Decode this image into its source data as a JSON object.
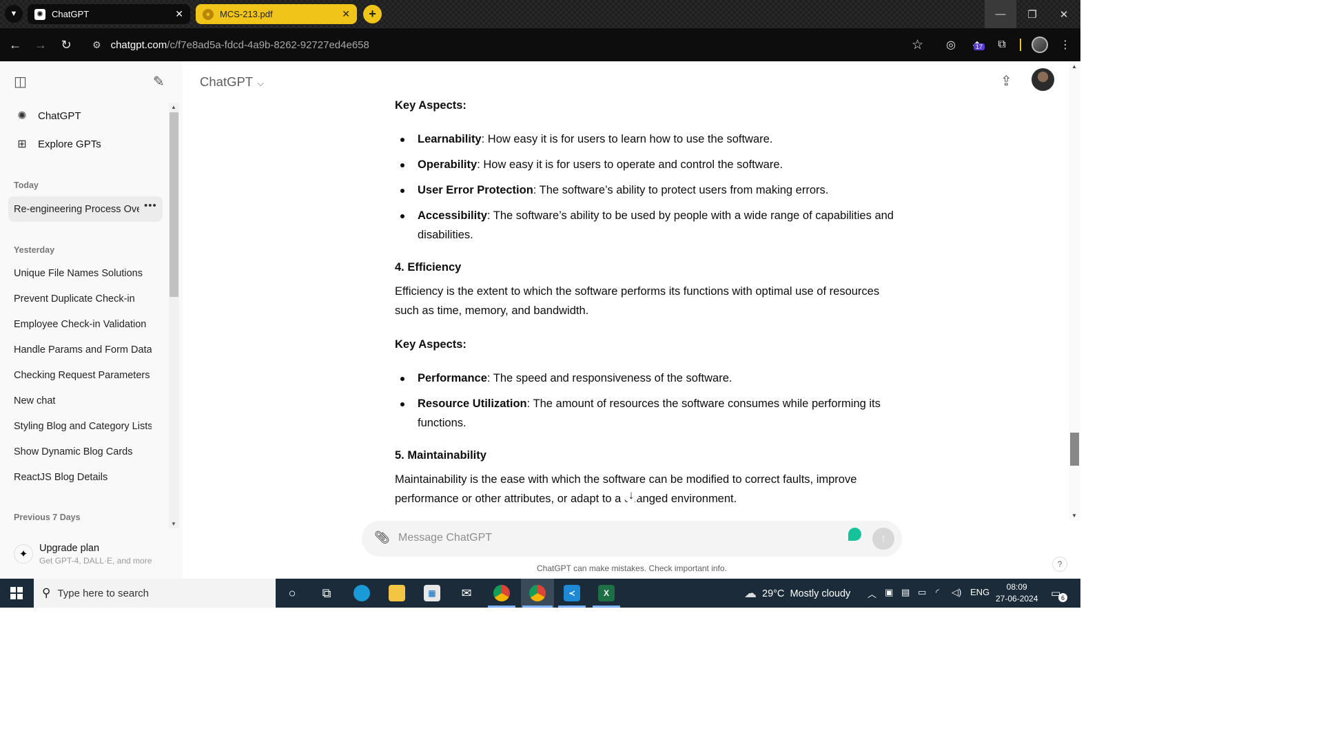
{
  "browser": {
    "tabs": [
      {
        "title": "ChatGPT",
        "favicon": "openai-icon"
      },
      {
        "title": "MCS-213.pdf",
        "favicon": "pdf-icon"
      }
    ],
    "url_host": "chatgpt.com",
    "url_path": "/c/f7e8ad5a-fdcd-4a9b-8262-92727ed4e658",
    "extension_badge": "17",
    "tab_group_color": "#f0c419"
  },
  "sidebar": {
    "nav": [
      {
        "label": "ChatGPT",
        "icon": "openai-icon"
      },
      {
        "label": "Explore GPTs",
        "icon": "grid-icon"
      }
    ],
    "today_header": "Today",
    "active_chat": "Re-engineering Process Overview",
    "yesterday_header": "Yesterday",
    "yesterday": [
      "Unique File Names Solutions",
      "Prevent Duplicate Check-in",
      "Employee Check-in Validation",
      "Handle Params and Form Data",
      "Checking Request Parameters",
      "New chat",
      "Styling Blog and Category Lists",
      "Show Dynamic Blog Cards",
      "ReactJS Blog Details"
    ],
    "previous_header": "Previous 7 Days",
    "upgrade_title": "Upgrade plan",
    "upgrade_sub": "Get GPT-4, DALL·E, and more"
  },
  "main": {
    "model_name": "ChatGPT",
    "content": {
      "key1": "Key Aspects:",
      "b1_term": "Learnability",
      "b1_text": ": How easy it is for users to learn how to use the software.",
      "b2_term": "Operability",
      "b2_text": ": How easy it is for users to operate and control the software.",
      "b3_term": "User Error Protection",
      "b3_text": ": The software’s ability to protect users from making errors.",
      "b4_term": "Accessibility",
      "b4_text": ": The software’s ability to be used by people with a wide range of capabilities and",
      "b4_text2": "disabilities.",
      "h4": "4. Efficiency",
      "p4_1": "Efficiency is the extent to which the software performs its functions with optimal use of resources",
      "p4_2": "such as time, memory, and bandwidth.",
      "key2": "Key Aspects:",
      "b5_term": "Performance",
      "b5_text": ": The speed and responsiveness of the software.",
      "b6_term": "Resource Utilization",
      "b6_text": ": The amount of resources the software consumes while performing its",
      "b6_text2": "functions.",
      "h5": "5. Maintainability",
      "p5_1": "Maintainability is the ease with which the software can be modified to correct faults, improve",
      "p5_2": "performance or other attributes, or adapt to a changed environment."
    },
    "composer_placeholder": "Message ChatGPT",
    "disclaimer": "ChatGPT can make mistakes. Check important info.",
    "help": "?"
  },
  "taskbar": {
    "search_placeholder": "Type here to search",
    "weather_temp": "29°C",
    "weather_desc": "Mostly cloudy",
    "language": "ENG",
    "time": "08:09",
    "date": "27-06-2024",
    "notifications": "6"
  }
}
